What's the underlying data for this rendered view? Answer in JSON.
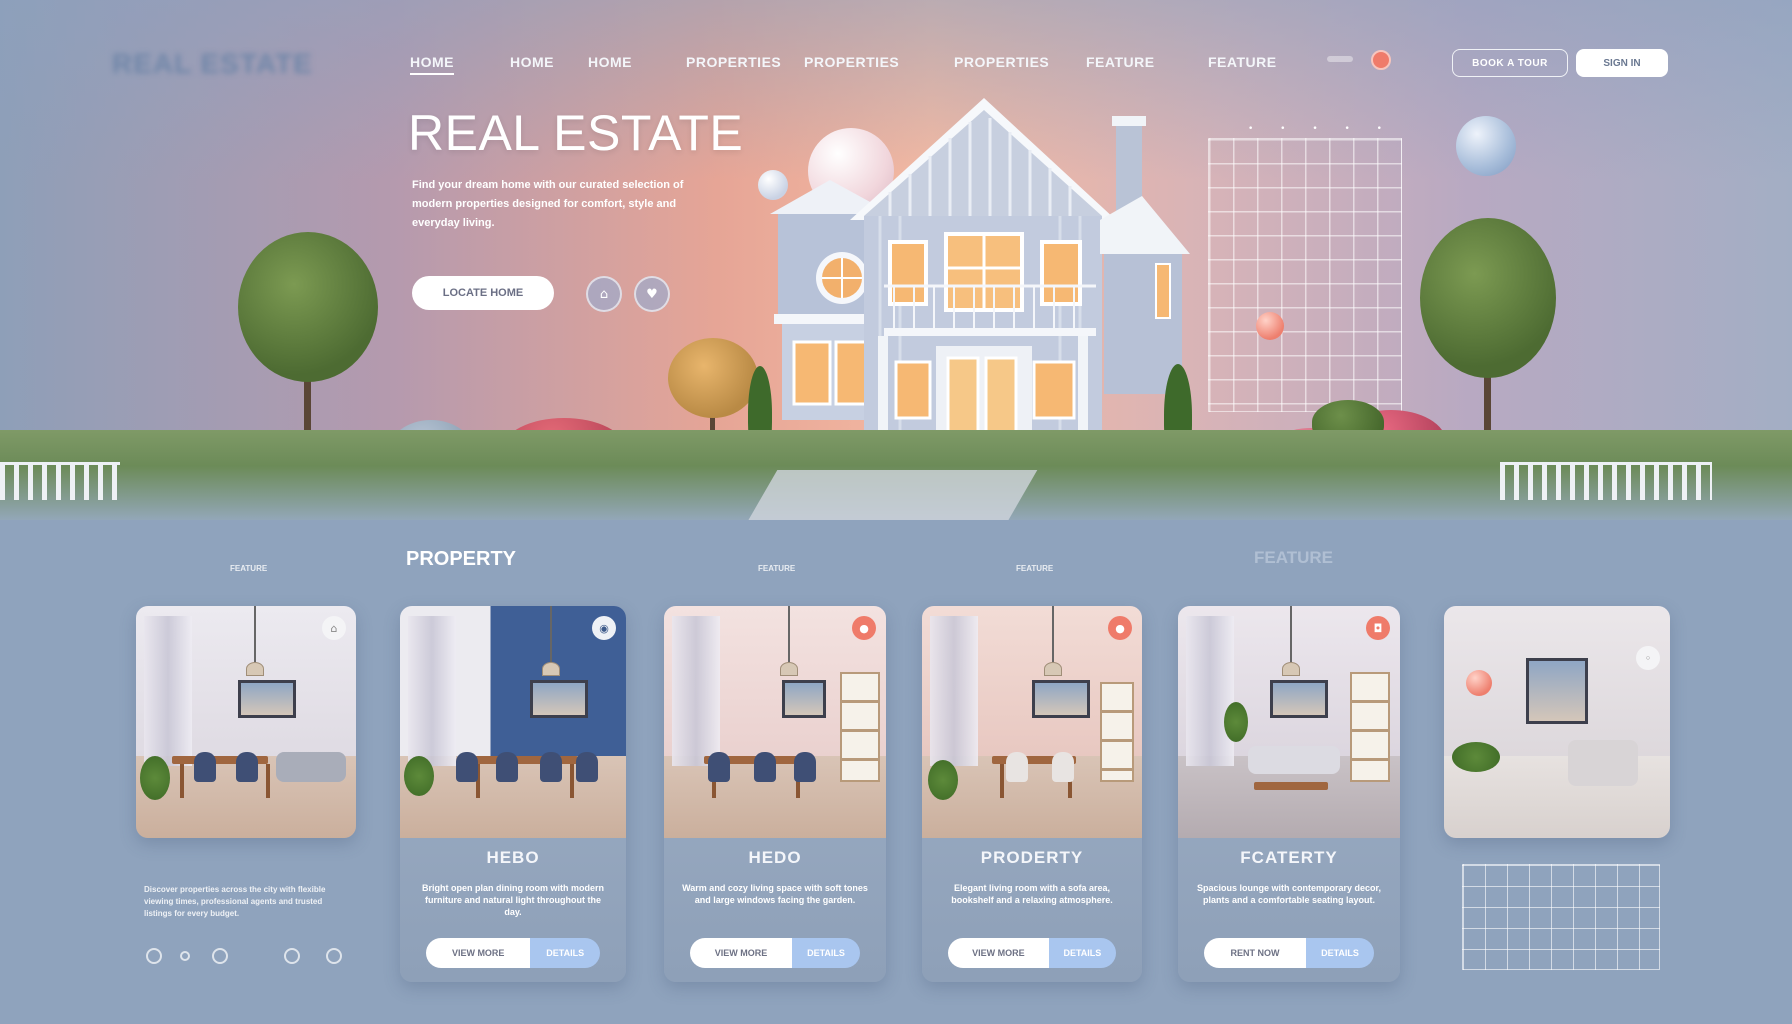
{
  "nav": {
    "logo": "REAL ESTATE",
    "items": [
      "HOME",
      "HOME",
      "HOME",
      "PROPERTIES",
      "PROPERTIES",
      "PROPERTIES",
      "FEATURE",
      "FEATURE"
    ],
    "btn_outline": "BOOK A TOUR",
    "btn_solid": "SIGN IN"
  },
  "hero": {
    "title": "REAL ESTATE",
    "description": "Find your dream home with our curated selection of modern properties designed for comfort, style and everyday living.",
    "cta": "LOCATE HOME",
    "icons": [
      "home-icon",
      "heart-icon"
    ]
  },
  "sections": {
    "left_small": "FEATURE",
    "property": "PROPERTY",
    "mid_small_1": "FEATURE",
    "mid_small_2": "FEATURE",
    "feature": "FEATURE"
  },
  "cards": [
    {
      "title": "",
      "badge": "home-icon"
    },
    {
      "title": "HEBO",
      "desc": "Bright open plan dining room with modern furniture and natural light throughout the day.",
      "btn1": "VIEW MORE",
      "btn2": "DETAILS",
      "badge": "circle-icon"
    },
    {
      "title": "HEDO",
      "desc": "Warm and cozy living space with soft tones and large windows facing the garden.",
      "btn1": "VIEW MORE",
      "btn2": "DETAILS",
      "badge": "pin-icon"
    },
    {
      "title": "PRODERTY",
      "desc": "Elegant living room with a sofa area, bookshelf and a relaxing atmosphere.",
      "btn1": "VIEW MORE",
      "btn2": "DETAILS",
      "badge": "pin-icon"
    },
    {
      "title": "FCATERTY",
      "desc": "Spacious lounge with contemporary decor, plants and a comfortable seating layout.",
      "btn1": "RENT NOW",
      "btn2": "DETAILS",
      "badge": "camera-icon"
    },
    {
      "title": "",
      "badge": "dot-icon"
    }
  ],
  "side_text": "Discover properties across the city with flexible viewing times, professional agents and trusted listings for every budget.",
  "colors": {
    "accent": "#ef7b6a",
    "button_blue": "#a9c6ef",
    "page_bg": "#8fa3bd"
  }
}
